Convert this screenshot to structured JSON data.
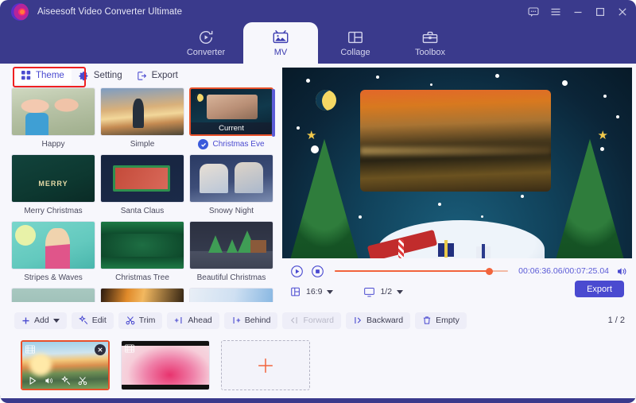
{
  "window": {
    "app_title": "Aiseesoft Video Converter Ultimate",
    "controls": [
      {
        "name": "feedback-icon",
        "label": "Feedback"
      },
      {
        "name": "menu-icon",
        "label": "Menu"
      },
      {
        "name": "minimize-icon",
        "label": "Minimize"
      },
      {
        "name": "maximize-icon",
        "label": "Maximize"
      },
      {
        "name": "close-icon",
        "label": "Close"
      }
    ]
  },
  "tabs": [
    {
      "label": "Converter",
      "icon": "converter-icon",
      "active": false
    },
    {
      "label": "MV",
      "icon": "mv-icon",
      "active": true
    },
    {
      "label": "Collage",
      "icon": "collage-icon",
      "active": false
    },
    {
      "label": "Toolbox",
      "icon": "toolbox-icon",
      "active": false
    }
  ],
  "subnav": [
    {
      "label": "Theme",
      "icon": "grid-dots-icon",
      "active": true,
      "annotated": true
    },
    {
      "label": "Setting",
      "icon": "gear-icon",
      "active": false
    },
    {
      "label": "Export",
      "icon": "export-icon",
      "active": false
    }
  ],
  "themes": [
    {
      "label": "Happy",
      "art": "art-happy",
      "selected": false
    },
    {
      "label": "Simple",
      "art": "art-simple",
      "selected": false
    },
    {
      "label": "Christmas Eve",
      "art": "art-xmaseve",
      "selected": true,
      "badge": "Current"
    },
    {
      "label": "Merry Christmas",
      "art": "art-merry",
      "selected": false
    },
    {
      "label": "Santa Claus",
      "art": "art-santa",
      "selected": false
    },
    {
      "label": "Snowy Night",
      "art": "art-snowy",
      "selected": false
    },
    {
      "label": "Stripes & Waves",
      "art": "art-stripes",
      "selected": false
    },
    {
      "label": "Christmas Tree",
      "art": "art-tree",
      "selected": false
    },
    {
      "label": "Beautiful Christmas",
      "art": "art-beautiful",
      "selected": false
    }
  ],
  "player": {
    "timecode": "00:06:36.06/00:07:25.04",
    "current_time": "00:06:36.06",
    "total_time": "00:07:25.04",
    "progress_percent": 89,
    "aspect_ratio": "16:9",
    "scale": "1/2",
    "export_label": "Export",
    "play_icon": "play-circle-icon",
    "stop_icon": "stop-circle-icon",
    "volume_icon": "volume-icon",
    "aspect_icon": "aspect-ratio-icon",
    "scale_icon": "monitor-icon"
  },
  "toolbar": {
    "buttons": [
      {
        "label": "Add",
        "icon": "plus-icon",
        "dropdown": true,
        "disabled": false
      },
      {
        "label": "Edit",
        "icon": "magic-wand-icon",
        "dropdown": false,
        "disabled": false
      },
      {
        "label": "Trim",
        "icon": "scissors-icon",
        "dropdown": false,
        "disabled": false
      },
      {
        "label": "Ahead",
        "icon": "insert-ahead-icon",
        "dropdown": false,
        "disabled": false
      },
      {
        "label": "Behind",
        "icon": "insert-behind-icon",
        "dropdown": false,
        "disabled": false
      },
      {
        "label": "Forward",
        "icon": "move-forward-icon",
        "dropdown": false,
        "disabled": true
      },
      {
        "label": "Backward",
        "icon": "move-backward-icon",
        "dropdown": false,
        "disabled": false
      },
      {
        "label": "Empty",
        "icon": "trash-icon",
        "dropdown": false,
        "disabled": false
      }
    ],
    "page_count": "1 / 2"
  },
  "filmstrip": {
    "clips": [
      {
        "art": "clip-art1",
        "selected": true,
        "has_close": true,
        "actions": [
          "play-icon",
          "volume-icon",
          "magic-wand-icon",
          "scissors-icon"
        ]
      },
      {
        "art": "clip-art2",
        "selected": false,
        "has_close": false,
        "actions": []
      }
    ],
    "add_label": "+"
  },
  "colors": {
    "header_purple": "#3a3a8c",
    "body_bg": "#f7f7fc",
    "accent_blue": "#4a4ad0",
    "accent_orange": "#f2643c",
    "selection_border": "#e8502a",
    "annotation_red": "#ef2020",
    "scrollbar": "#5b5bd6"
  }
}
